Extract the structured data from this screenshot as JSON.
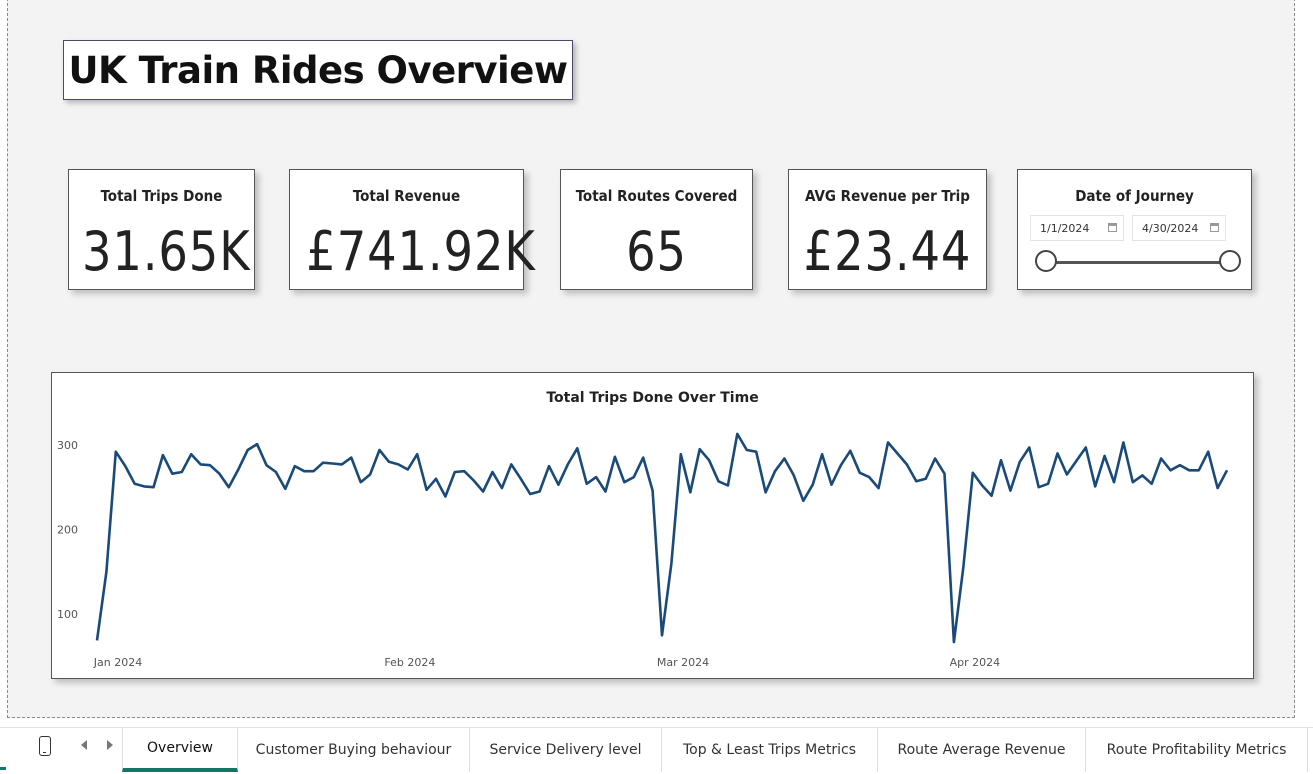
{
  "report": {
    "title": "UK Train Rides Overview"
  },
  "kpis": [
    {
      "label": "Total Trips Done",
      "value": "31.65K"
    },
    {
      "label": "Total Revenue",
      "value": "£741.92K"
    },
    {
      "label": "Total Routes Covered",
      "value": "65"
    },
    {
      "label": "AVG Revenue per Trip",
      "value": "£23.44"
    }
  ],
  "date_slicer": {
    "label": "Date of Journey",
    "start": "1/1/2024",
    "end": "4/30/2024",
    "range_selected": [
      0,
      1
    ]
  },
  "colors": {
    "line": "#1a4a7a",
    "active_tab": "#117865"
  },
  "icons": {
    "calendar": "calendar-icon",
    "mobile": "mobile-layout-icon"
  },
  "chart_data": {
    "type": "line",
    "title": "Total Trips Done Over Time",
    "xlabel": "",
    "ylabel": "",
    "x_tick_labels": [
      "Jan 2024",
      "Feb 2024",
      "Mar 2024",
      "Apr 2024"
    ],
    "y_ticks": [
      100,
      200,
      300
    ],
    "ylim": [
      60,
      320
    ],
    "xlim": [
      "2024-01-01",
      "2024-04-30"
    ],
    "grid": false,
    "series": [
      {
        "start_date": "2024-01-01",
        "values": [
          69,
          150,
          292,
          275,
          254,
          251,
          250,
          288,
          266,
          268,
          289,
          277,
          276,
          266,
          250,
          271,
          294,
          301,
          276,
          268,
          248,
          275,
          269,
          269,
          279,
          278,
          277,
          285,
          256,
          265,
          294,
          280,
          277,
          271,
          289,
          247,
          260,
          239,
          268,
          269,
          258,
          245,
          268,
          249,
          277,
          260,
          242,
          245,
          275,
          253,
          277,
          296,
          254,
          262,
          245,
          286,
          256,
          262,
          285,
          246,
          75,
          160,
          289,
          244,
          295,
          282,
          257,
          252,
          313,
          294,
          292,
          244,
          269,
          284,
          264,
          234,
          253,
          289,
          253,
          276,
          293,
          267,
          262,
          249,
          303,
          290,
          277,
          257,
          260,
          284,
          266,
          67,
          155,
          267,
          252,
          240,
          282,
          246,
          280,
          297,
          250,
          254,
          290,
          265,
          281,
          297,
          251,
          287,
          256,
          303,
          256,
          264,
          254,
          284,
          270,
          276,
          270,
          270,
          292,
          249,
          270
        ]
      }
    ]
  },
  "tabs": [
    {
      "label": "Overview",
      "active": true
    },
    {
      "label": "Customer Buying behaviour",
      "active": false
    },
    {
      "label": "Service Delivery level",
      "active": false
    },
    {
      "label": "Top & Least Trips Metrics",
      "active": false
    },
    {
      "label": "Route Average Revenue",
      "active": false
    },
    {
      "label": "Route Profitability Metrics",
      "active": false
    }
  ]
}
